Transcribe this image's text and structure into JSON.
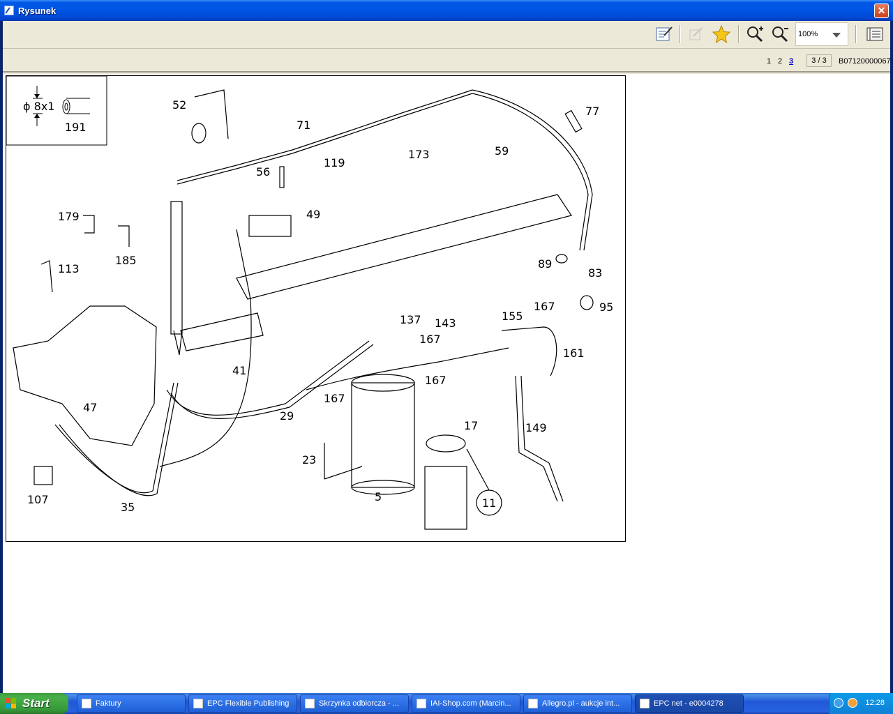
{
  "window": {
    "title": "Rysunek",
    "close_label": "✕"
  },
  "toolbar": {
    "icons": [
      "edit-notes-icon",
      "expand-icon",
      "favorite-star-icon",
      "zoom-in-icon",
      "zoom-out-icon",
      "page-view-icon"
    ],
    "zoom_value": "100%"
  },
  "navbar": {
    "pages": [
      "1",
      "2",
      "3"
    ],
    "current_page": "3",
    "page_indicator": "3 / 3",
    "doc_code": "B07120000067"
  },
  "drawing": {
    "inset": {
      "diameter_label": "ϕ 8x1",
      "part": "191"
    },
    "labels": [
      "52",
      "71",
      "77",
      "56",
      "119",
      "173",
      "59",
      "49",
      "179",
      "185",
      "113",
      "89",
      "83",
      "167",
      "95",
      "137",
      "143",
      "155",
      "167",
      "161",
      "41",
      "167",
      "167",
      "47",
      "29",
      "17",
      "149",
      "23",
      "107",
      "35",
      "5",
      "11"
    ]
  },
  "taskbar": {
    "start_label": "Start",
    "tasks": [
      "Faktury",
      "EPC Flexible Publishing",
      "Skrzynka odbiorcza - ...",
      "IAI-Shop.com (Marcin...",
      "Allegro.pl - aukcje int...",
      "EPC net - e0004278"
    ],
    "clock": "12:28"
  }
}
